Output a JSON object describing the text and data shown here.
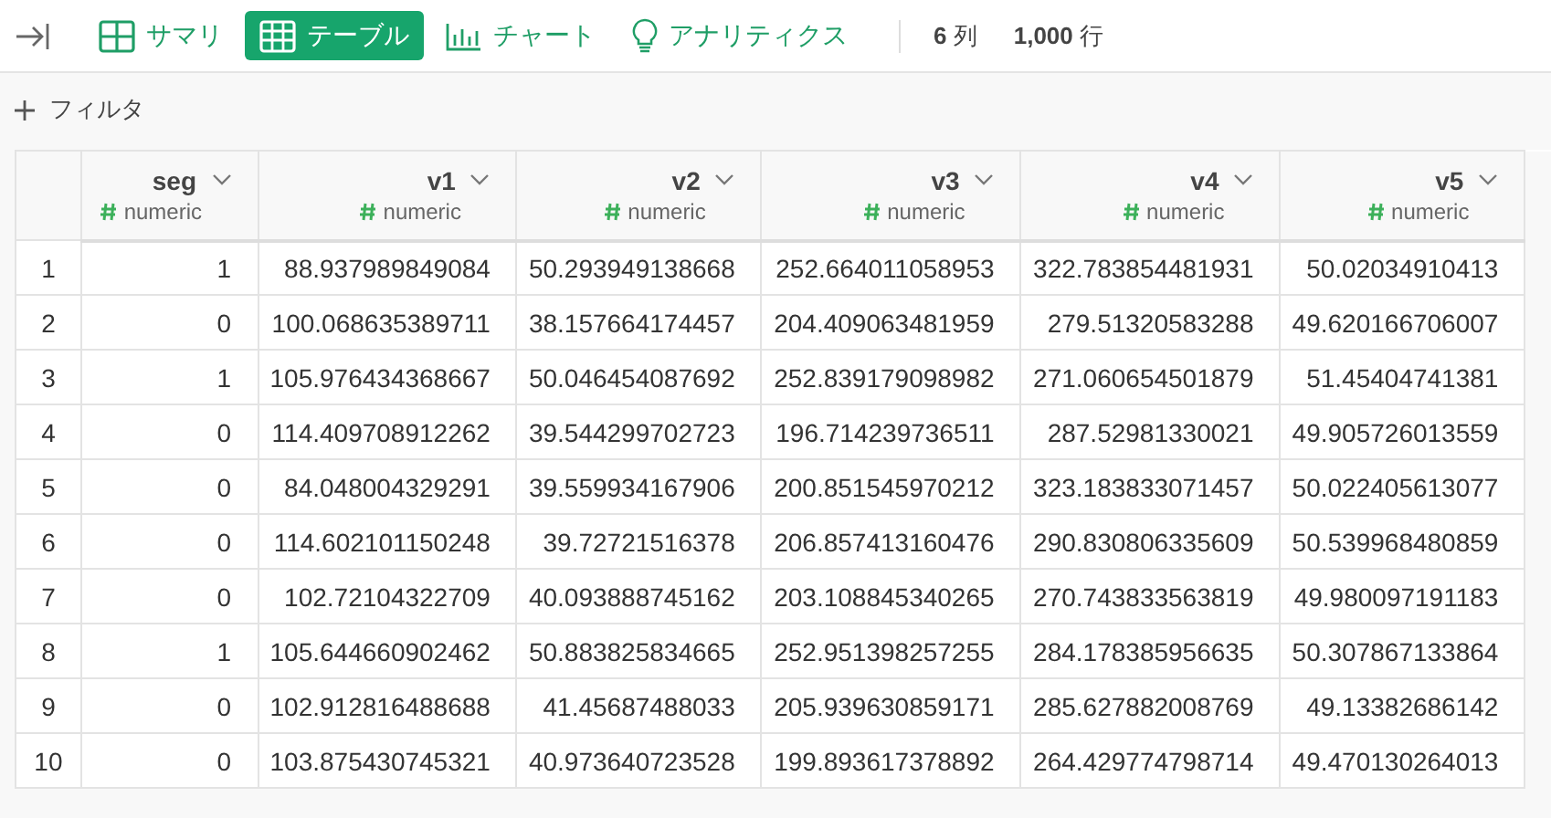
{
  "toolbar": {
    "tabs": [
      {
        "label": "サマリ",
        "selected": false
      },
      {
        "label": "テーブル",
        "selected": true
      },
      {
        "label": "チャート",
        "selected": false
      },
      {
        "label": "アナリティクス",
        "selected": false
      }
    ],
    "stats": [
      {
        "value": "6",
        "unit": "列"
      },
      {
        "value": "1,000",
        "unit": "行"
      }
    ]
  },
  "filter": {
    "label": "フィルタ"
  },
  "table": {
    "columns": [
      {
        "name": "seg",
        "type": "numeric"
      },
      {
        "name": "v1",
        "type": "numeric"
      },
      {
        "name": "v2",
        "type": "numeric"
      },
      {
        "name": "v3",
        "type": "numeric"
      },
      {
        "name": "v4",
        "type": "numeric"
      },
      {
        "name": "v5",
        "type": "numeric"
      }
    ],
    "rows": [
      {
        "index": "1",
        "cells": [
          "1",
          "88.937989849084",
          "50.293949138668",
          "252.664011058953",
          "322.783854481931",
          "50.02034910413"
        ]
      },
      {
        "index": "2",
        "cells": [
          "0",
          "100.068635389711",
          "38.157664174457",
          "204.409063481959",
          "279.51320583288",
          "49.620166706007"
        ]
      },
      {
        "index": "3",
        "cells": [
          "1",
          "105.976434368667",
          "50.046454087692",
          "252.839179098982",
          "271.060654501879",
          "51.45404741381"
        ]
      },
      {
        "index": "4",
        "cells": [
          "0",
          "114.409708912262",
          "39.544299702723",
          "196.714239736511",
          "287.52981330021",
          "49.905726013559"
        ]
      },
      {
        "index": "5",
        "cells": [
          "0",
          "84.048004329291",
          "39.559934167906",
          "200.851545970212",
          "323.183833071457",
          "50.022405613077"
        ]
      },
      {
        "index": "6",
        "cells": [
          "0",
          "114.602101150248",
          "39.72721516378",
          "206.857413160476",
          "290.830806335609",
          "50.539968480859"
        ]
      },
      {
        "index": "7",
        "cells": [
          "0",
          "102.72104322709",
          "40.093888745162",
          "203.108845340265",
          "270.743833563819",
          "49.980097191183"
        ]
      },
      {
        "index": "8",
        "cells": [
          "1",
          "105.644660902462",
          "50.883825834665",
          "252.951398257255",
          "284.178385956635",
          "50.307867133864"
        ]
      },
      {
        "index": "9",
        "cells": [
          "0",
          "102.912816488688",
          "41.45687488033",
          "205.939630859171",
          "285.627882008769",
          "49.13382686142"
        ]
      },
      {
        "index": "10",
        "cells": [
          "0",
          "103.875430745321",
          "40.973640723528",
          "199.893617378892",
          "264.429774798714",
          "49.470130264013"
        ]
      }
    ]
  }
}
